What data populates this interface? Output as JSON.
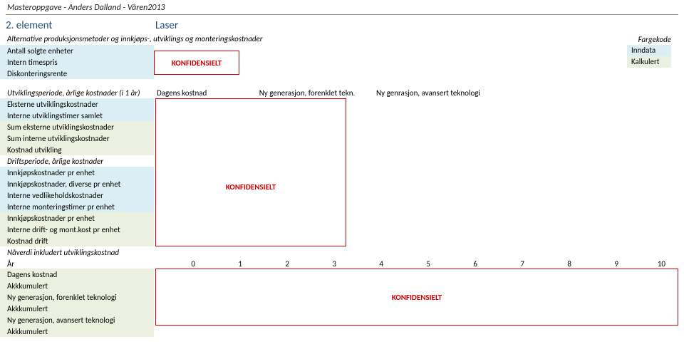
{
  "header": "Masteroppgave - Anders Dalland - Våren2013",
  "section": {
    "num": "2. element",
    "name": "Laser"
  },
  "subtitle": "Alternative produksjonsmetoder og innkjøps-, utviklings og monteringskostnader",
  "legend": {
    "title": "Fargekode",
    "inndata": "Inndata",
    "kalkulert": "Kalkulert"
  },
  "inputLabels": {
    "antall": "Antall solgte enheter",
    "intern": "Intern timespris",
    "disk": "Diskonteringsrente"
  },
  "konfidensielt": "KONFIDENSIELT",
  "tableHead": {
    "rowHeader": "Utviklingsperiode, årlige kostnader (i 1 år)",
    "col1": "Dagens kostnad",
    "col2": "Ny generasjon, forenklet tekn.",
    "col3": "Ny genrasjon, avansert teknologi"
  },
  "utvikling": [
    {
      "label": "Eksterne utviklingskostnader",
      "cls": "inndata"
    },
    {
      "label": "Interne utviklingstimer samlet",
      "cls": "inndata"
    },
    {
      "label": "Sum eksterne utviklingskostnader",
      "cls": "kalkulert"
    },
    {
      "label": "Sum interne utviklingskostnader",
      "cls": "kalkulert"
    },
    {
      "label": "Kostnad utvikling",
      "cls": "kalkulert"
    }
  ],
  "driftHeader": "Driftsperiode, årlige kostnader",
  "drift": [
    {
      "label": "Innkjøpskostnader pr enhet",
      "cls": "inndata"
    },
    {
      "label": "Innkjøpskostnader, diverse pr enhet",
      "cls": "inndata"
    },
    {
      "label": "Interne vedlikeholdskostnader",
      "cls": "inndata"
    },
    {
      "label": "Interne monteringstimer pr enhet",
      "cls": "inndata"
    },
    {
      "label": "Innkjøpskostnader pr enhet",
      "cls": "kalkulert"
    },
    {
      "label": "Interne drift- og mont.kost pr enhet",
      "cls": "kalkulert"
    },
    {
      "label": "Kostnad drift",
      "cls": "kalkulert"
    }
  ],
  "naaverdi": "Nåverdi inkludert utviklingskostnad",
  "yearLabel": "År",
  "years": [
    "0",
    "1",
    "2",
    "3",
    "4",
    "5",
    "6",
    "7",
    "8",
    "9",
    "10"
  ],
  "bottom": [
    {
      "label": "Dagens kostnad",
      "cls": "kalkulert"
    },
    {
      "label": "Akkkumulert",
      "cls": "kalkulert"
    },
    {
      "label": "Ny generasjon, forenklet teknologi",
      "cls": "kalkulert"
    },
    {
      "label": "Akkkumulert",
      "cls": "kalkulert"
    },
    {
      "label": "Ny generasjon, avansert teknologi",
      "cls": "kalkulert"
    },
    {
      "label": "Akkkumulert",
      "cls": "kalkulert"
    }
  ]
}
